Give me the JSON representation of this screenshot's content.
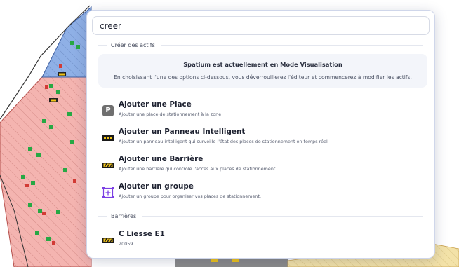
{
  "search": {
    "value": "creer"
  },
  "sections": {
    "create": "Créer des actifs",
    "barriers": "Barrières"
  },
  "notice": {
    "title": "Spatium est actuellement en Mode Visualisation",
    "text": "En choisissant l'une des options ci-dessous, vous déverrouillerez l'éditeur et commencerez à modifier les actifs."
  },
  "actions": [
    {
      "title": "Ajouter une Place",
      "subtitle": "Ajouter une place de stationnement à la zone",
      "icon": "parking-p-icon",
      "icon_letter": "P"
    },
    {
      "title": "Ajouter un Panneau Intelligent",
      "subtitle": "Ajouter un panneau intelligent qui surveille l'état des places de stationnement en temps réel",
      "icon": "smart-panel-icon"
    },
    {
      "title": "Ajouter une Barrière",
      "subtitle": "Ajouter une barrière qui contrôle l'accès aux places de stationnement",
      "icon": "barrier-icon"
    },
    {
      "title": "Ajouter un groupe",
      "subtitle": "Ajouter un groupe pour organiser vos places de stationnement.",
      "icon": "group-icon"
    }
  ],
  "barrier_results": [
    {
      "title": "C Liesse E1",
      "subtitle": "20059",
      "icon": "barrier-icon"
    }
  ],
  "colors": {
    "map_red_zone": "#f4b4b0",
    "map_blue_zone": "#8fb0e6",
    "map_yellow_zone": "#f3e2a8",
    "map_background": "#ffffff",
    "barrier_yellow": "#f0c419",
    "group_purple": "#7b3fe4"
  }
}
